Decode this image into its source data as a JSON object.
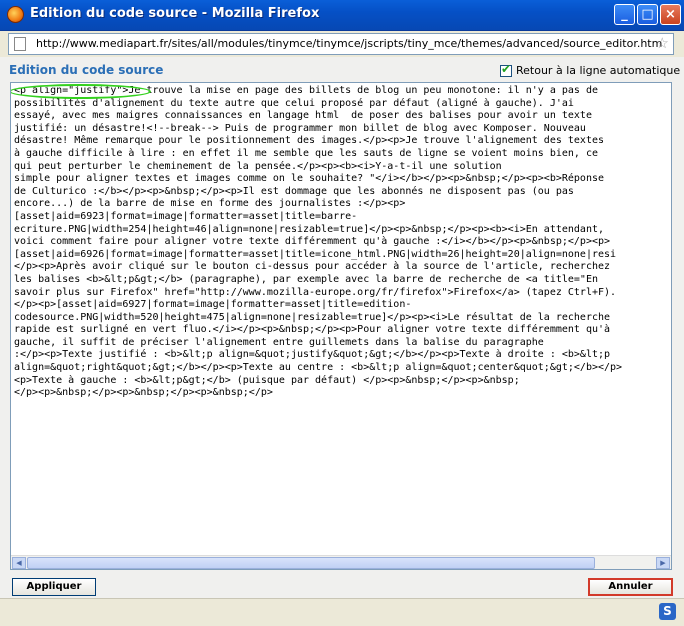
{
  "window": {
    "title": "Edition du code source - Mozilla Firefox"
  },
  "url": "http://www.mediapart.fr/sites/all/modules/tinymce/tinymce/jscripts/tiny_mce/themes/advanced/source_editor.htm",
  "dialog": {
    "heading": "Edition du code source",
    "wrap_label": "Retour à la ligne automatique",
    "wrap_checked": true,
    "apply_label": "Appliquer",
    "cancel_label": "Annuler",
    "source_lines": [
      "<p align=\"justify\">Je trouve la mise en page des billets de blog un peu monotone: il n'y a pas de",
      "possibilités d'alignement du texte autre que celui proposé par défaut (aligné à gauche). J'ai",
      "essayé, avec mes maigres connaissances en langage html  de poser des balises pour avoir un texte",
      "justifié: un désastre!<!--break--> Puis de programmer mon billet de blog avec Komposer. Nouveau",
      "désastre! Même remarque pour le positionnement des images.</p><p>Je trouve l'alignement des textes",
      "à gauche difficile à lire : en effet il me semble que les sauts de ligne se voient moins bien, ce",
      "qui peut perturber le cheminement de la pensée.</p><p><b><i>Y-a-t-il une solution",
      "simple pour aligner textes et images comme on le souhaite? \"</i></b></p><p>&nbsp;</p><p><b>Réponse",
      "de Culturico :</b></p><p>&nbsp;</p><p>Il est dommage que les abonnés ne disposent pas (ou pas",
      "encore...) de la barre de mise en forme des journalistes :</p><p>",
      "[asset|aid=6923|format=image|formatter=asset|title=barre-",
      "ecriture.PNG|width=254|height=46|align=none|resizable=true]</p><p>&nbsp;</p><p><b><i>En attendant,",
      "voici comment faire pour aligner votre texte différemment qu'à gauche :</i></b></p><p>&nbsp;</p><p>",
      "[asset|aid=6926|format=image|formatter=asset|title=icone_html.PNG|width=26|height=20|align=none|resi",
      "</p><p>Après avoir cliqué sur le bouton ci-dessus pour accéder à la source de l'article, recherchez",
      "les balises <b>&lt;p&gt;</b> (paragraphe), par exemple avec la barre de recherche de <a title=\"En",
      "savoir plus sur Firefox\" href=\"http://www.mozilla-europe.org/fr/firefox\">Firefox</a> (tapez Ctrl+F).",
      "</p><p>[asset|aid=6927|format=image|formatter=asset|title=edition-",
      "codesource.PNG|width=520|height=475|align=none|resizable=true]</p><p><i>Le résultat de la recherche",
      "rapide est surligné en vert fluo.</i></p><p>&nbsp;</p><p>Pour aligner votre texte différemment qu'à",
      "gauche, il suffit de préciser l'alignement entre guillemets dans la balise du paragraphe",
      ":</p><p>Texte justifié : <b>&lt;p align=&quot;justify&quot;&gt;</b></p><p>Texte à droite : <b>&lt;p",
      "align=&quot;right&quot;&gt;</b></p><p>Texte au centre : <b>&lt;p align=&quot;center&quot;&gt;</b></p>",
      "<p>Texte à gauche : <b>&lt;p&gt;</b> (puisque par défaut) </p><p>&nbsp;</p><p>&nbsp;",
      "</p><p>&nbsp;</p><p>&nbsp;</p><p>&nbsp;</p>"
    ]
  },
  "icons": {
    "app": "firefox-icon",
    "minimize": "_",
    "maximize": "□",
    "close": "×",
    "bookmark": "☆",
    "status": "S"
  },
  "colors": {
    "title_bar": "#0550c6",
    "heading": "#2b6fb6",
    "highlight": "#34d11e",
    "cancel_border": "#d23a2a"
  }
}
